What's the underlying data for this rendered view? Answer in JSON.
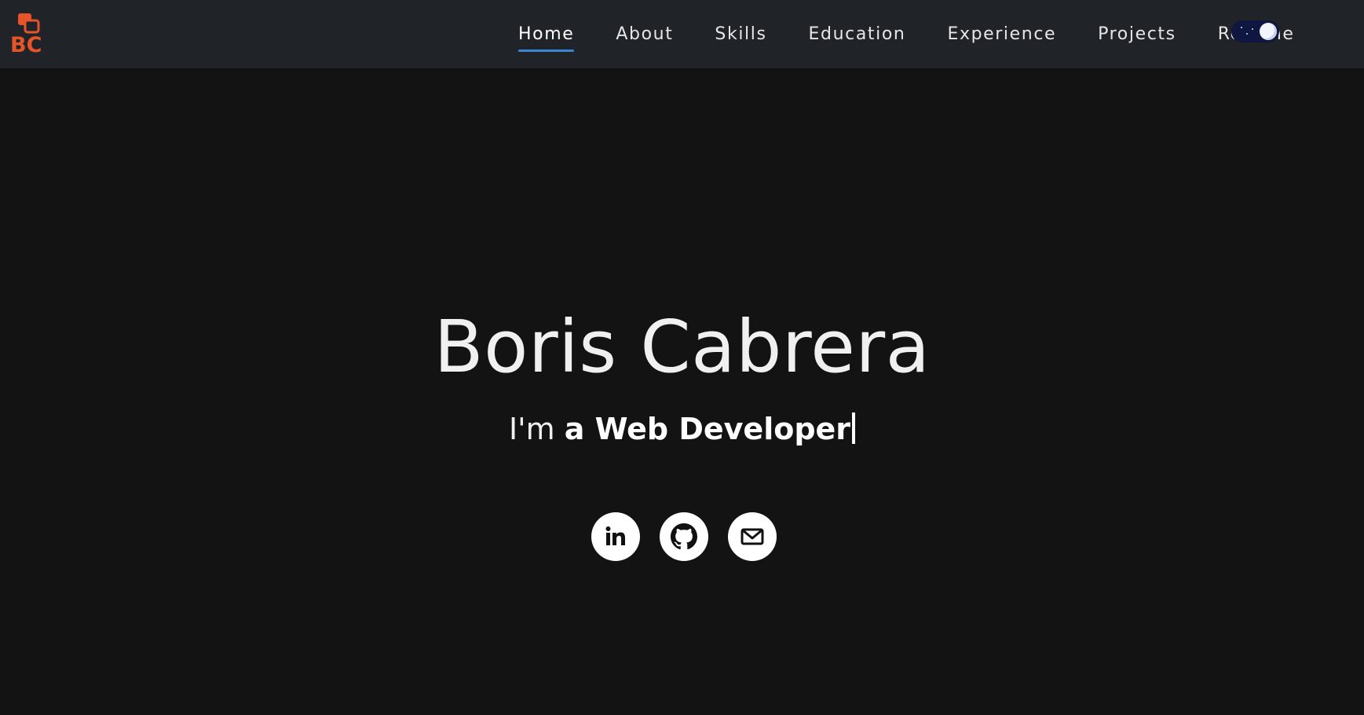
{
  "nav": {
    "logo": {
      "text": "BC",
      "accent": "#e8542a",
      "icon": "bc-logo"
    },
    "links": [
      {
        "label": "Home",
        "active": true
      },
      {
        "label": "About"
      },
      {
        "label": "Skills"
      },
      {
        "label": "Education"
      },
      {
        "label": "Experience"
      },
      {
        "label": "Projects"
      },
      {
        "label": "Resume"
      }
    ],
    "active_underline_color": "#3b86d4",
    "theme_toggle": {
      "icon": "moon-icon",
      "state": "dark"
    }
  },
  "hero": {
    "name": "Boris Cabrera",
    "tagline_prefix": "I'm ",
    "tagline_role": "a Web Developer",
    "socials": [
      {
        "icon": "linkedin-icon"
      },
      {
        "icon": "github-icon"
      },
      {
        "icon": "mail-icon"
      }
    ]
  },
  "colors": {
    "background": "#131313",
    "navbar": "#202328",
    "text": "#f0f0f0"
  }
}
